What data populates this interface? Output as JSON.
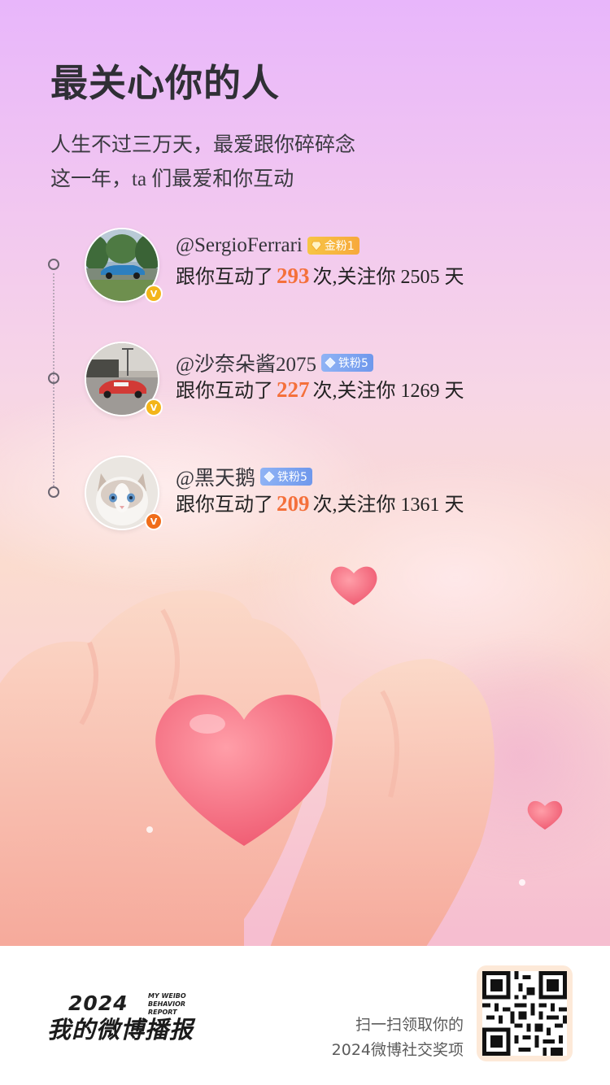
{
  "header": {
    "title": "最关心你的人",
    "subtitle_line1": "人生不过三万天，最爱跟你碎碎念",
    "subtitle_line2": "这一年，ta 们最爱和你互动"
  },
  "users": [
    {
      "handle": "@SergioFerrari",
      "fan_badge": "金粉1",
      "fan_badge_type": "gold",
      "verified_color": "#f3b51a",
      "stat_prefix": "跟你互动了",
      "count": "293",
      "stat_middle": "次,关注你",
      "days": "2505",
      "stat_suffix": "天",
      "avatar_icon": "blue-car-photo"
    },
    {
      "handle": "@沙奈朵酱2075",
      "fan_badge": "铁粉5",
      "fan_badge_type": "iron",
      "verified_color": "#f3b51a",
      "stat_prefix": "跟你互动了",
      "count": "227",
      "stat_middle": "次,关注你",
      "days": "1269",
      "stat_suffix": "天",
      "avatar_icon": "red-car-photo"
    },
    {
      "handle": "@黑天鹅",
      "fan_badge": "铁粉5",
      "fan_badge_type": "iron",
      "verified_color": "#f06d1a",
      "stat_prefix": "跟你互动了",
      "count": "209",
      "stat_middle": "次,关注你",
      "days": "1361",
      "stat_suffix": "天",
      "avatar_icon": "white-cat-photo"
    }
  ],
  "verified_glyph": "V",
  "footer": {
    "brand_year": "2024",
    "brand_tag_line1": "MY WEIBO",
    "brand_tag_line2": "BEHAVIOR REPORT",
    "brand_title": "我的微博播报",
    "promo_line1": "扫一扫领取你的",
    "promo_line2": "2024微博社交奖项"
  },
  "colors": {
    "accent_count": "#f4703b",
    "gold_badge": "#f7b940",
    "iron_badge": "#7ea6f0"
  }
}
